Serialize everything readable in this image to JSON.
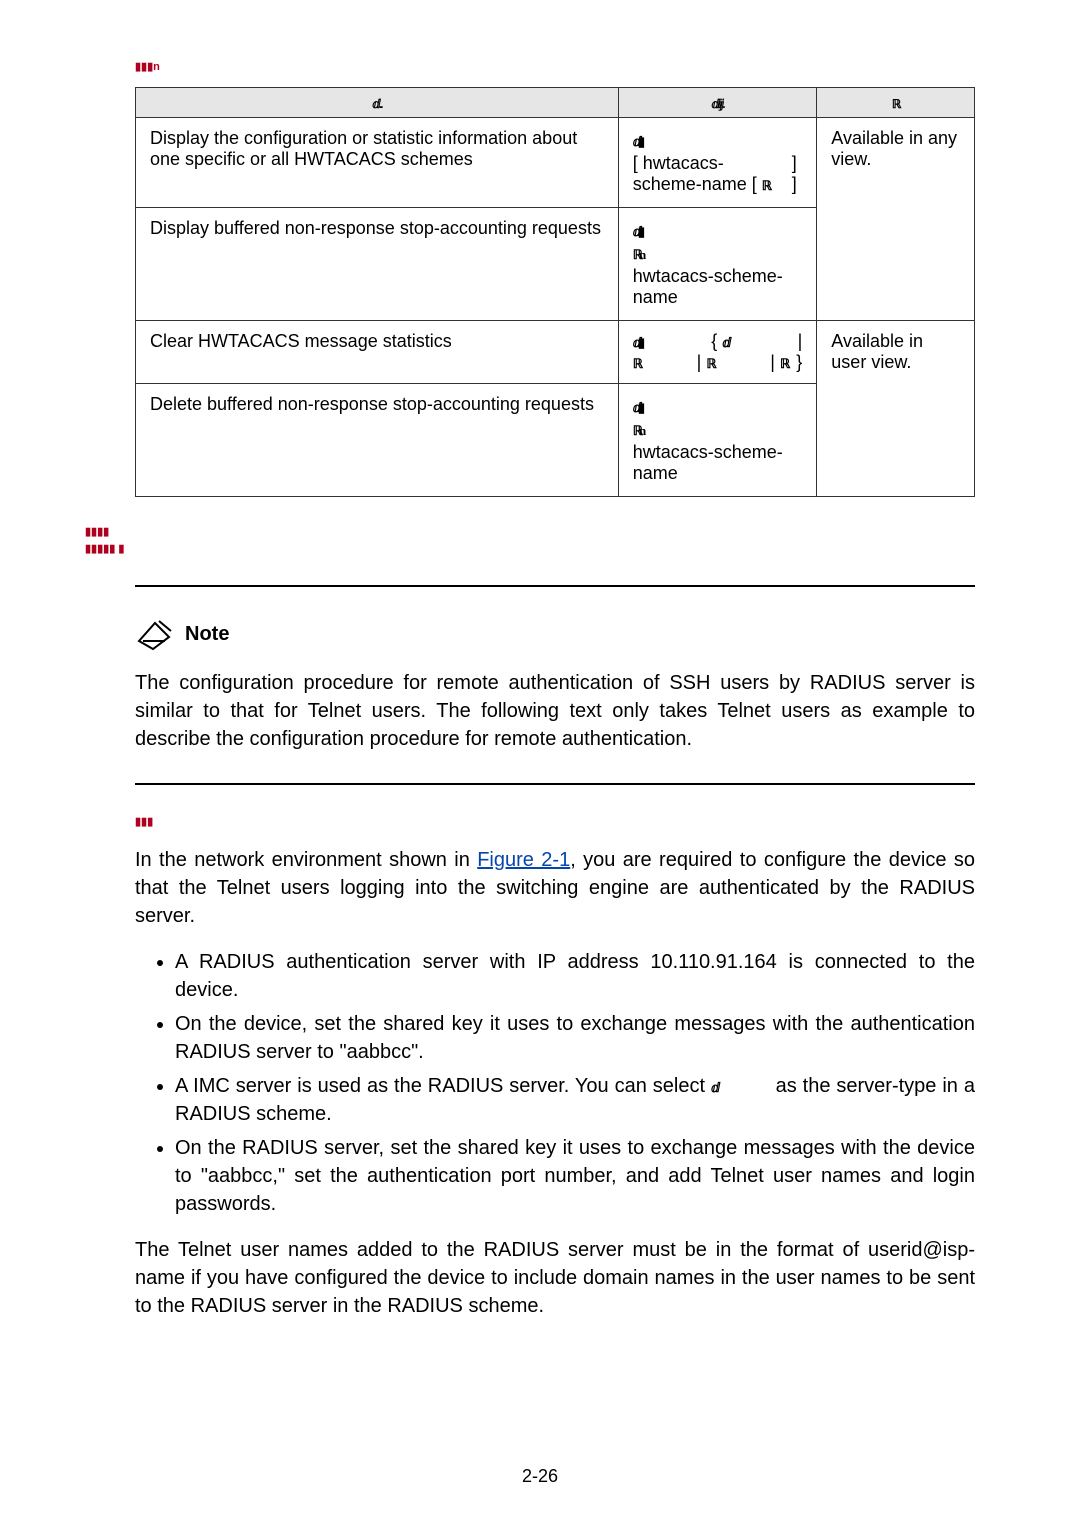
{
  "topLabel": "▮▮▮n",
  "table": {
    "head": {
      "c1": "ⅆ..",
      "c2": "ⅆⅈⅉ.",
      "c3": "ℝ"
    },
    "rows": [
      {
        "todo": "Display the configuration or statistic information about one specific or all HWTACACS schemes",
        "cmdGlyph1": "ⅆ▮",
        "cmdLine": "[ hwtacacs-scheme-name [",
        "cmdGlyph2": "ℝ",
        "cmdTail": "] ]",
        "remarks": "Available in any view."
      },
      {
        "todo": "Display buffered non-response stop-accounting requests",
        "cmdGlyph1": "ⅆ▮",
        "cmdGlyph2": "ℝn",
        "cmdLine2": "hwtacacs-scheme-name"
      },
      {
        "todo": "Clear HWTACACS message statistics",
        "g1": "ⅆ▮",
        "brace1": "{",
        "g2": "ⅆ",
        "pipe": "|",
        "g3": "ℝ",
        "g4": "ℝ",
        "g5": "ℝ",
        "brace2": "}",
        "remarks": "Available in user view."
      },
      {
        "todo": "Delete buffered non-response stop-accounting requests",
        "cmdGlyph1": "ⅆ▮",
        "cmdGlyph2": "ℝn",
        "cmdLine2": "hwtacacs-scheme-name"
      }
    ]
  },
  "sideLabel1": "▮▮▮▮",
  "sideLabel2": "▮▮▮▮▮ ▮",
  "noteLabel": "Note",
  "notePara": "The configuration procedure for remote authentication of SSH users by RADIUS server is similar to that for Telnet users. The following text only takes Telnet users as example to describe the configuration procedure for remote authentication.",
  "subhead": "▮▮▮",
  "intro1": "In the network environment shown in ",
  "figureLink": "Figure 2-1",
  "intro2": ", you are required to configure the device so that the Telnet users logging into the switching engine are authenticated by the RADIUS server.",
  "bullets": [
    "A RADIUS authentication server with IP address 10.110.91.164 is connected to the device.",
    "On the device, set the shared key it uses to exchange messages with the authentication RADIUS server to \"aabbcc\".",
    {
      "pre": "A IMC server is used as the RADIUS server. You can select ",
      "glyph": "ⅆ",
      "post": " as the server-type in a RADIUS scheme."
    },
    "On the RADIUS server, set the shared key it uses to exchange messages with the device to \"aabbcc,\" set the authentication port number, and   add Telnet user names and login passwords."
  ],
  "closing": "The Telnet user names added to the RADIUS server must be in the format of userid@isp-name if you have configured the device to include domain names in the user names to be sent to the RADIUS server in the RADIUS scheme.",
  "pageNum": "2-26"
}
